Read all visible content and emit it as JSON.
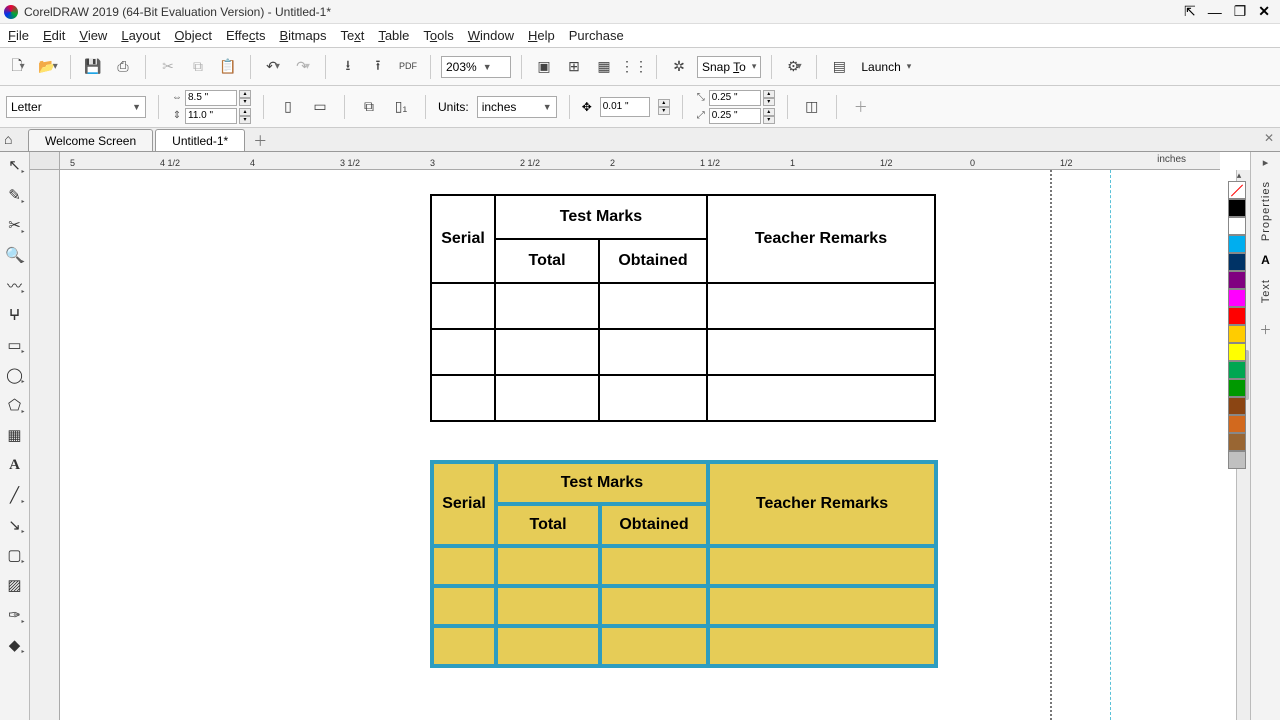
{
  "app": {
    "title": "CorelDRAW 2019 (64-Bit Evaluation Version) - Untitled-1*"
  },
  "menu": [
    "File",
    "Edit",
    "View",
    "Layout",
    "Object",
    "Effects",
    "Bitmaps",
    "Text",
    "Table",
    "Tools",
    "Window",
    "Help",
    "Purchase"
  ],
  "toolbar": {
    "zoom": "203%",
    "snap_label": "Snap To",
    "launch_label": "Launch"
  },
  "propbar": {
    "page_preset": "Letter",
    "page_w": "8.5 \"",
    "page_h": "11.0 \"",
    "units_label": "Units:",
    "units_value": "inches",
    "nudge": "0.01 \"",
    "dup_x": "0.25 \"",
    "dup_y": "0.25 \""
  },
  "tabs": {
    "welcome": "Welcome Screen",
    "doc1": "Untitled-1*"
  },
  "ruler": {
    "unit_label": "inches",
    "hticks": [
      "5",
      "4 1/2",
      "4",
      "3 1/2",
      "3",
      "2 1/2",
      "2",
      "1 1/2",
      "1",
      "1/2",
      "0",
      "1/2"
    ]
  },
  "right": {
    "properties": "Properties",
    "text": "Text"
  },
  "palette": [
    "#000000",
    "#ffffff",
    "#00aeef",
    "#003366",
    "#800080",
    "#ff00ff",
    "#ff0000",
    "#ffcc00",
    "#ffff00",
    "#00a651",
    "#009900",
    "#8b4513",
    "#d2691e",
    "#996633",
    "#c0c0c0"
  ],
  "table": {
    "serial": "Serial",
    "test_marks": "Test Marks",
    "total": "Total",
    "obtained": "Obtained",
    "remarks": "Teacher Remarks"
  }
}
